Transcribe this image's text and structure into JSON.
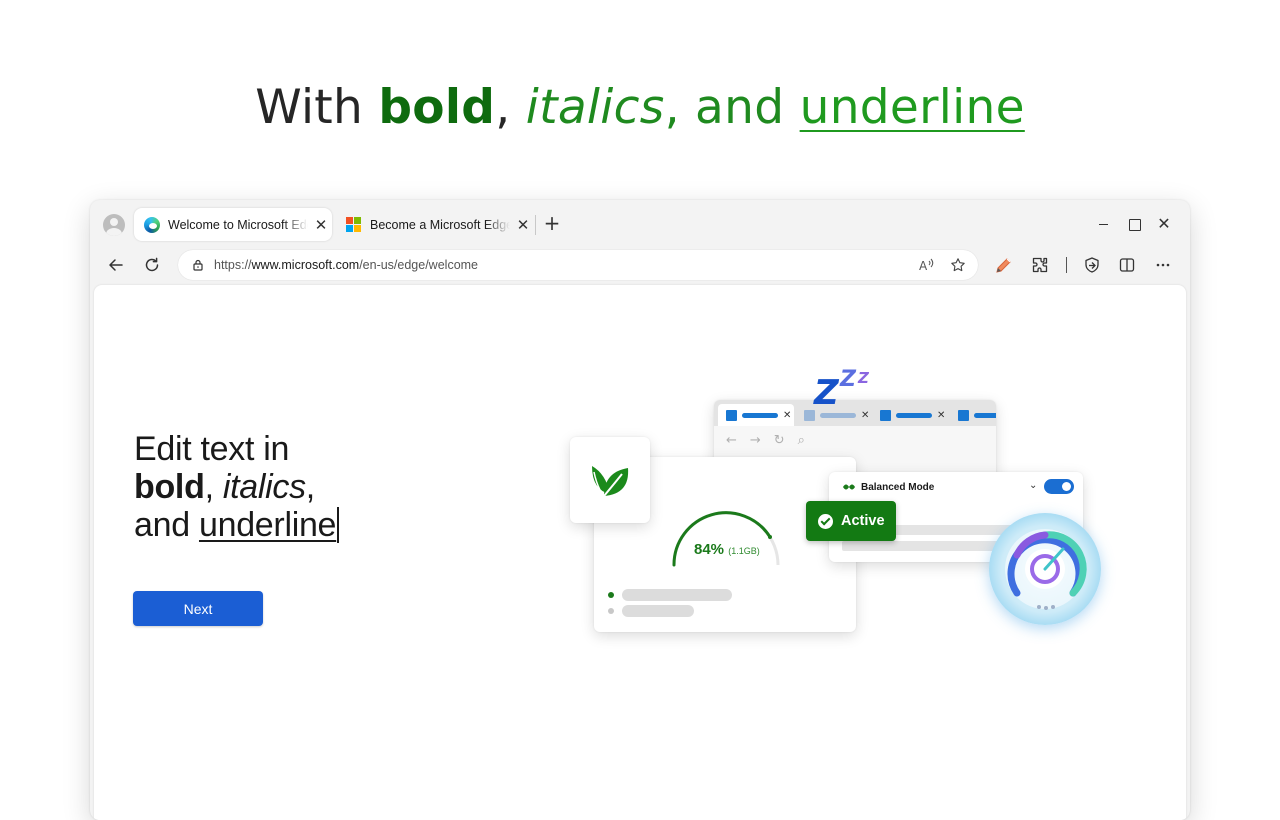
{
  "headline": {
    "prefix": "With ",
    "bold": "bold",
    "comma1": ", ",
    "italic": "italics",
    "comma2": ", and ",
    "underline": "underline"
  },
  "browser": {
    "tabs": [
      {
        "title": "Welcome to Microsoft Edge",
        "icon": "edge-logo-icon",
        "active": true
      },
      {
        "title": "Become a Microsoft Edge Insider",
        "icon": "microsoft-logo-icon",
        "active": false
      }
    ],
    "new_tab_label": "+",
    "close_glyph": "✕",
    "address": {
      "prefix": "https://",
      "domain": "www.microsoft.com",
      "path": "/en-us/edge/welcome"
    },
    "toolbar_icons": [
      "back-icon",
      "refresh-icon",
      "lock-icon",
      "read-aloud-icon",
      "favorite-star-icon",
      "pencil-icon",
      "extensions-icon",
      "browser-essentials-icon",
      "split-screen-icon",
      "more-icon"
    ],
    "window_controls": [
      "minimize-icon",
      "maximize-icon",
      "close-icon"
    ]
  },
  "page": {
    "edit_text": {
      "line1": "Edit text in",
      "bold": "bold",
      "comma1": ", ",
      "italic": "italics",
      "comma2": ",",
      "line3_prefix": "and ",
      "underline": "underline"
    },
    "next_button": "Next",
    "illustration": {
      "zzz": [
        "Z",
        "Z",
        "Z"
      ],
      "gauge_percent": "84%",
      "gauge_memory": "(1.1GB)",
      "balanced_mode": "Balanced Mode",
      "active_label": "Active",
      "toggle_on": true
    }
  },
  "colors": {
    "headline_bold": "#0e6b0e",
    "headline_accent": "#1f9a1f",
    "next_button": "#1b5ed4",
    "active_badge": "#137a13",
    "toggle": "#1b6ed2"
  }
}
